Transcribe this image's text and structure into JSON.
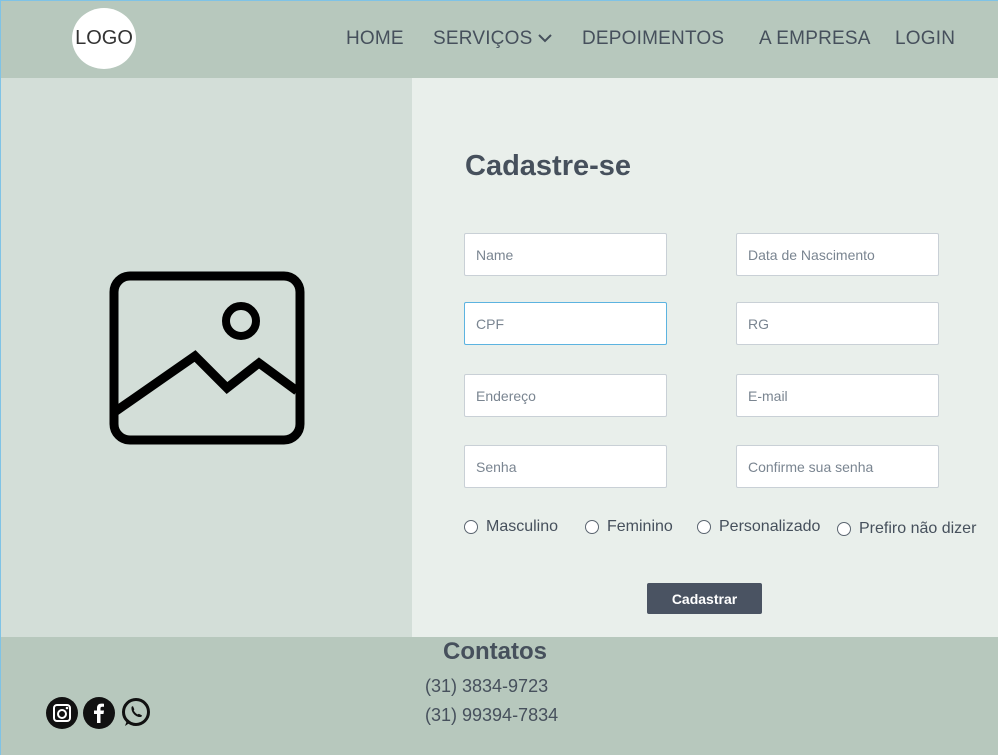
{
  "header": {
    "logo_text": "LOGO",
    "nav": {
      "home": "HOME",
      "services": "SERVIÇOS",
      "testimonials": "DEPOIMENTOS",
      "company": "A EMPRESA",
      "login": "LOGIN"
    }
  },
  "form": {
    "title": "Cadastre-se",
    "fields": {
      "name": "Name",
      "birth_date": "Data de Nascimento",
      "cpf": "CPF",
      "rg": "RG",
      "address": "Endereço",
      "email": "E-mail",
      "password": "Senha",
      "confirm_password": "Confirme sua senha"
    },
    "gender_options": {
      "male": "Masculino",
      "female": "Feminino",
      "custom": "Personalizado",
      "prefer_not": "Prefiro não dizer"
    },
    "submit_label": "Cadastrar"
  },
  "footer": {
    "title": "Contatos",
    "phones": [
      "(31) 3834-9723",
      "(31) 99394-7834"
    ],
    "social_icons": [
      "instagram-icon",
      "facebook-icon",
      "whatsapp-icon"
    ]
  },
  "colors": {
    "header_bg": "#b7c8bd",
    "left_panel_bg": "#d3ded8",
    "form_panel_bg": "#e9efeb",
    "text": "#46505c",
    "button_bg": "#4a5362",
    "focus_border": "#5cb3e0"
  }
}
